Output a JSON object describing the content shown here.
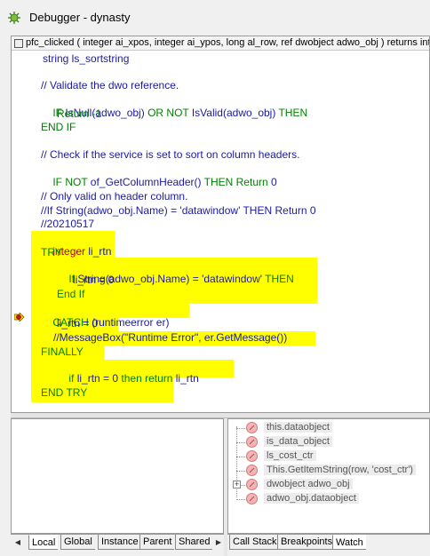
{
  "window": {
    "title": "Debugger - dynasty"
  },
  "editor": {
    "function_signature": "pfc_clicked ( integer ai_xpos, integer ai_ypos, long al_row, ref dwobject adwo_obj )  returns integer",
    "lines": [
      "string ls_sortstring",
      "",
      "// Validate the dwo reference.",
      "IF IsNull(adwo_obj) OR NOT IsValid(adwo_obj) THEN",
      "    Return -1",
      "END IF",
      "",
      "// Check if the service is set to sort on column headers.",
      "IF NOT of_GetColumnHeader() THEN Return 0",
      "",
      "// Only valid on header column.",
      "//If String(adwo_obj.Name) = 'datawindow' THEN Return 0",
      "//20210517",
      "integer li_rtn",
      "TRY",
      "    If String(adwo_obj.Name) = 'datawindow' THEN",
      "        li_rtn = 0",
      "    End If",
      "CATCH (runtimeerror er)",
      "    li_rtn = 0",
      "   //MessageBox(\"Runtime Error\", er.GetMessage())",
      "FINALLY",
      "    if li_rtn = 0 then return li_rtn",
      "",
      "END TRY"
    ],
    "highlight_color": "#ffff00",
    "keyword_color": "#008000",
    "text_color": "#1a1aa6",
    "current_line_icon": "breakpoint-arrow-icon"
  },
  "watch": {
    "items": [
      "this.dataobject",
      "is_data_object",
      "ls_cost_ctr",
      "This.GetItemString(row, 'cost_ctr')",
      "dwobject adwo_obj",
      "adwo_obj.dataobject"
    ],
    "item_icon": "invalid-watch-icon"
  },
  "tabs_left": [
    "Local",
    "Global",
    "Instance",
    "Parent",
    "Shared"
  ],
  "tabs_right": [
    "Call Stack",
    "Breakpoints",
    "Watch"
  ],
  "active_tab_right": "Watch"
}
